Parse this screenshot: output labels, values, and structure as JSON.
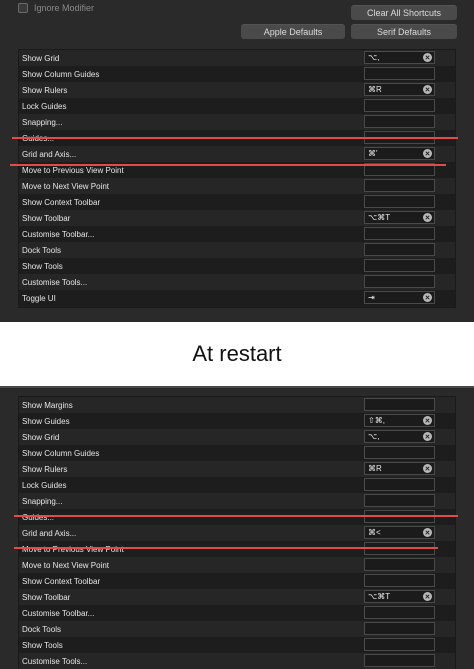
{
  "top_panel": {
    "ignore_modifier": "Ignore Modifier",
    "clear_all": "Clear All Shortcuts",
    "apple_defaults": "Apple Defaults",
    "serif_defaults": "Serif Defaults",
    "rows": [
      {
        "label": "Show Grid",
        "shortcut": "⌥,"
      },
      {
        "label": "Show Column Guides",
        "shortcut": ""
      },
      {
        "label": "Show Rulers",
        "shortcut": "⌘R"
      },
      {
        "label": "Lock Guides",
        "shortcut": ""
      },
      {
        "label": "Snapping...",
        "shortcut": ""
      },
      {
        "label": "Guides...",
        "shortcut": ""
      },
      {
        "label": "Grid and Axis...",
        "shortcut": "⌘'"
      },
      {
        "label": "Move to Previous View Point",
        "shortcut": ""
      },
      {
        "label": "Move to Next View Point",
        "shortcut": ""
      },
      {
        "label": "Show Context Toolbar",
        "shortcut": ""
      },
      {
        "label": "Show Toolbar",
        "shortcut": "⌥⌘T"
      },
      {
        "label": "Customise Toolbar...",
        "shortcut": ""
      },
      {
        "label": "Dock Tools",
        "shortcut": ""
      },
      {
        "label": "Show Tools",
        "shortcut": ""
      },
      {
        "label": "Customise Tools...",
        "shortcut": ""
      },
      {
        "label": "Toggle UI",
        "shortcut": "⇥"
      }
    ]
  },
  "caption": "At restart",
  "bottom_panel": {
    "rows": [
      {
        "label": "Show Margins",
        "shortcut": ""
      },
      {
        "label": "Show Guides",
        "shortcut": "⇧⌘,"
      },
      {
        "label": "Show Grid",
        "shortcut": "⌥,"
      },
      {
        "label": "Show Column Guides",
        "shortcut": ""
      },
      {
        "label": "Show Rulers",
        "shortcut": "⌘R"
      },
      {
        "label": "Lock Guides",
        "shortcut": ""
      },
      {
        "label": "Snapping...",
        "shortcut": ""
      },
      {
        "label": "Guides...",
        "shortcut": ""
      },
      {
        "label": "Grid and Axis...",
        "shortcut": "⌘<"
      },
      {
        "label": "Move to Previous View Point",
        "shortcut": ""
      },
      {
        "label": "Move to Next View Point",
        "shortcut": ""
      },
      {
        "label": "Show Context Toolbar",
        "shortcut": ""
      },
      {
        "label": "Show Toolbar",
        "shortcut": "⌥⌘T"
      },
      {
        "label": "Customise Toolbar...",
        "shortcut": ""
      },
      {
        "label": "Dock Tools",
        "shortcut": ""
      },
      {
        "label": "Show Tools",
        "shortcut": ""
      },
      {
        "label": "Customise Tools...",
        "shortcut": ""
      }
    ]
  },
  "colors": {
    "panel_bg": "#2a2a2a",
    "strike_line": "#e34b4b",
    "clear_icon": "#b8b8b8"
  }
}
